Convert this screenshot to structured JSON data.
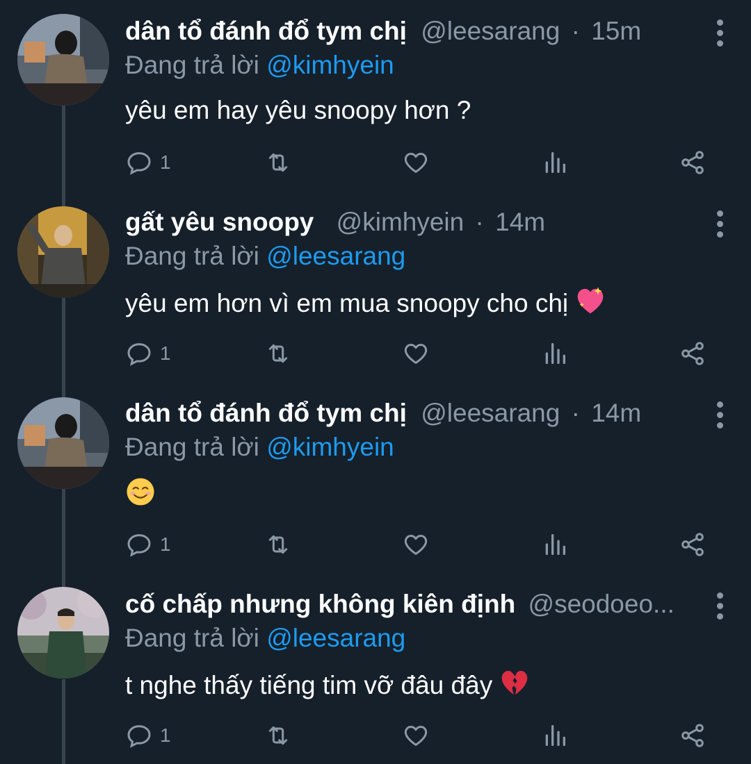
{
  "colors": {
    "background": "#15202b",
    "text_primary": "#ffffff",
    "text_secondary": "#8b98a5",
    "accent": "#1d9bf0",
    "thread_line": "#38444d"
  },
  "icons": {
    "reply": "reply-icon",
    "retweet": "retweet-icon",
    "like": "heart-icon",
    "views": "views-icon",
    "share": "share-icon",
    "more": "more-icon"
  },
  "tweets": [
    {
      "name": "dân tổ đánh đổ tym chị",
      "handle": "@leesarang",
      "separator": "·",
      "time": "15m",
      "reply_prefix": "Đang trả lời",
      "reply_to": "@kimhyein",
      "text": "yêu em hay yêu snoopy hơn ?",
      "emoji": "",
      "reply_count": "1"
    },
    {
      "name": "gất yêu snoopy",
      "handle": "@kimhyein",
      "separator": "·",
      "time": "14m",
      "reply_prefix": "Đang trả lời",
      "reply_to": "@leesarang",
      "text": "yêu em hơn vì em mua snoopy cho chị",
      "emoji": "sparkling-heart",
      "reply_count": "1"
    },
    {
      "name": "dân tổ đánh đổ tym chị",
      "handle": "@leesarang",
      "separator": "·",
      "time": "14m",
      "reply_prefix": "Đang trả lời",
      "reply_to": "@kimhyein",
      "text": "",
      "emoji": "smiling-face",
      "reply_count": "1"
    },
    {
      "name": "cố chấp nhưng không kiên định",
      "handle": "@seodoeo...",
      "separator": "",
      "time": "",
      "reply_prefix": "Đang trả lời",
      "reply_to": "@leesarang",
      "text": "t nghe thấy tiếng tim vỡ đâu đây",
      "emoji": "broken-heart",
      "reply_count": "1"
    }
  ]
}
